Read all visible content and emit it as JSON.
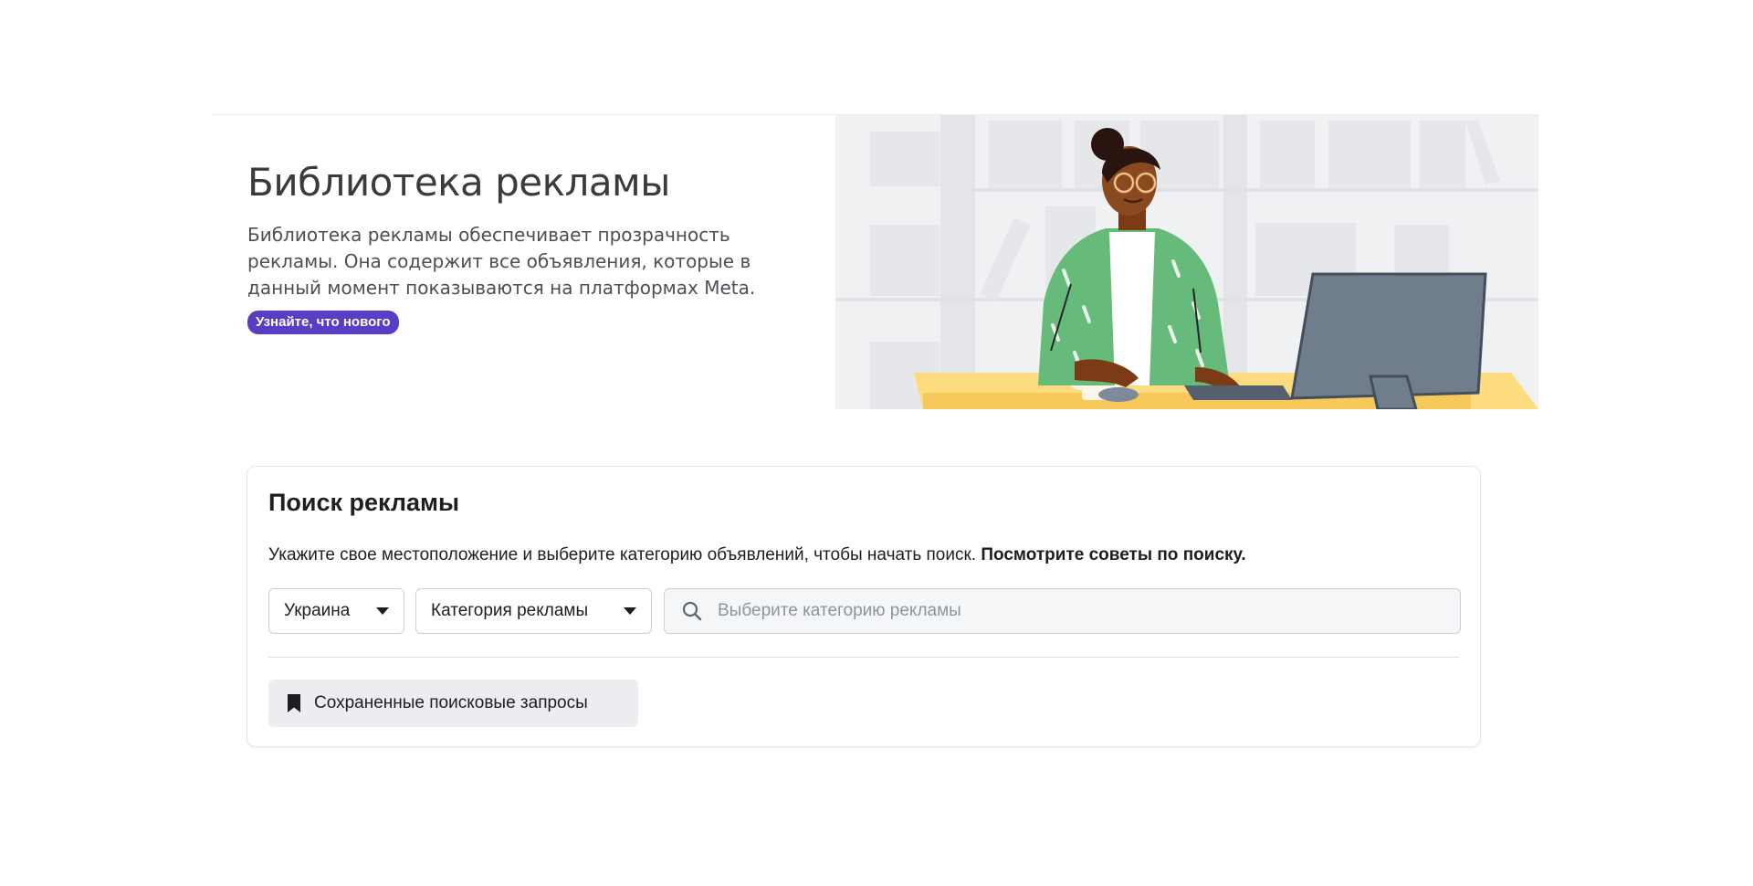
{
  "hero": {
    "title": "Библиотека рекламы",
    "description": "Библиотека рекламы обеспечивает прозрачность рекламы. Она содержит все объявления, которые в данный момент показываются на платформах Meta.",
    "badge_label": "Узнайте, что нового",
    "badge_color": "#5b3cc4",
    "illustration": "woman-working-at-computer-illustration"
  },
  "search_card": {
    "title": "Поиск рекламы",
    "instructions": "Укажите свое местоположение и выберите категорию объявлений, чтобы начать поиск.",
    "tips_link": "Посмотрите советы по поиску.",
    "country_select": {
      "value": "Украина",
      "icon": "caret-down-icon"
    },
    "category_select": {
      "value": "Категория рекламы",
      "icon": "caret-down-icon"
    },
    "search": {
      "placeholder": "Выберите категорию рекламы",
      "icon": "search-icon"
    },
    "saved_searches": {
      "label": "Сохраненные поисковые запросы",
      "icon": "bookmark-icon"
    }
  }
}
